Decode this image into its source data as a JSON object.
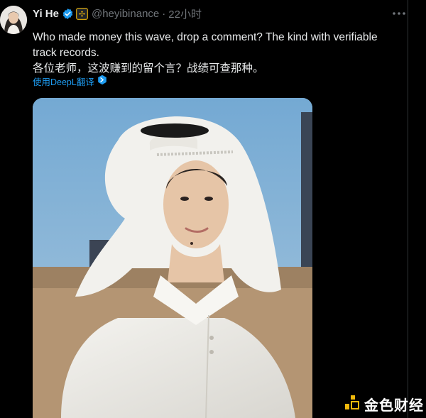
{
  "user": {
    "display_name": "Yi He",
    "handle": "@heyibinance",
    "separator": "·",
    "time": "22小时"
  },
  "tweet": {
    "text_en": "Who made money this wave, drop a comment? The kind with verifiable track records.",
    "text_zh": "各位老师，这波赚到的留个言？战绩可查那种。"
  },
  "translate": {
    "label": "使用DeepL翻译"
  },
  "watermark": {
    "text": "金色财经"
  },
  "colors": {
    "background": "#000000",
    "text": "#e7e9ea",
    "secondary": "#71767b",
    "link": "#1d9bf0",
    "verified": "#1d9bf0",
    "affiliation": "#f0b90b"
  },
  "icons": [
    "verified-badge-icon",
    "binance-affiliation-icon",
    "more-icon",
    "deepl-icon",
    "watermark-logo-icon"
  ]
}
